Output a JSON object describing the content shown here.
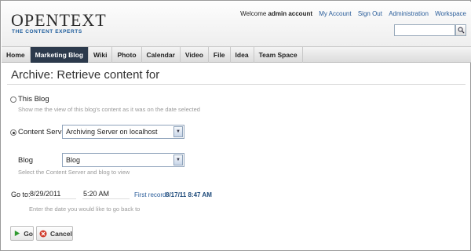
{
  "header": {
    "logo_main": "OPENTEXT",
    "logo_sub": "THE CONTENT EXPERTS",
    "welcome_label": "Welcome",
    "user_name": "admin account",
    "links": [
      "My Account",
      "Sign Out",
      "Administration",
      "Workspace"
    ],
    "search_value": ""
  },
  "nav": {
    "tabs": [
      "Home",
      "Marketing Blog",
      "Wiki",
      "Photo",
      "Calendar",
      "Video",
      "File",
      "Idea",
      "Team Space"
    ],
    "active": "Marketing Blog"
  },
  "page": {
    "title": "Archive:  Retrieve content for"
  },
  "form": {
    "this_blog_label": "This Blog",
    "this_blog_hint": "Show me the view of this blog's content as it was on the date selected",
    "content_server_label": "Content Server",
    "content_server_value": "Archiving Server on localhost",
    "blog_label": "Blog",
    "blog_value": "Blog",
    "blog_hint": "Select the Content Server and blog to view",
    "goto_label": "Go to:",
    "date_value": "8/29/2011",
    "time_value": "5:20 AM",
    "first_record_label": "First record:",
    "first_record_value": "8/17/11 8:47 AM",
    "date_hint": "Enter the date you would like to go back to",
    "selected_option": "Content Server"
  },
  "buttons": {
    "go": "Go",
    "cancel": "Cancel"
  },
  "colors": {
    "nav_active": "#2c3a4c",
    "link": "#2a5d9a",
    "go_icon": "#2f9a2f",
    "cancel_icon": "#d03a2a"
  },
  "icons": {
    "search": "search-icon",
    "go": "play-icon",
    "cancel": "cancel-icon"
  }
}
